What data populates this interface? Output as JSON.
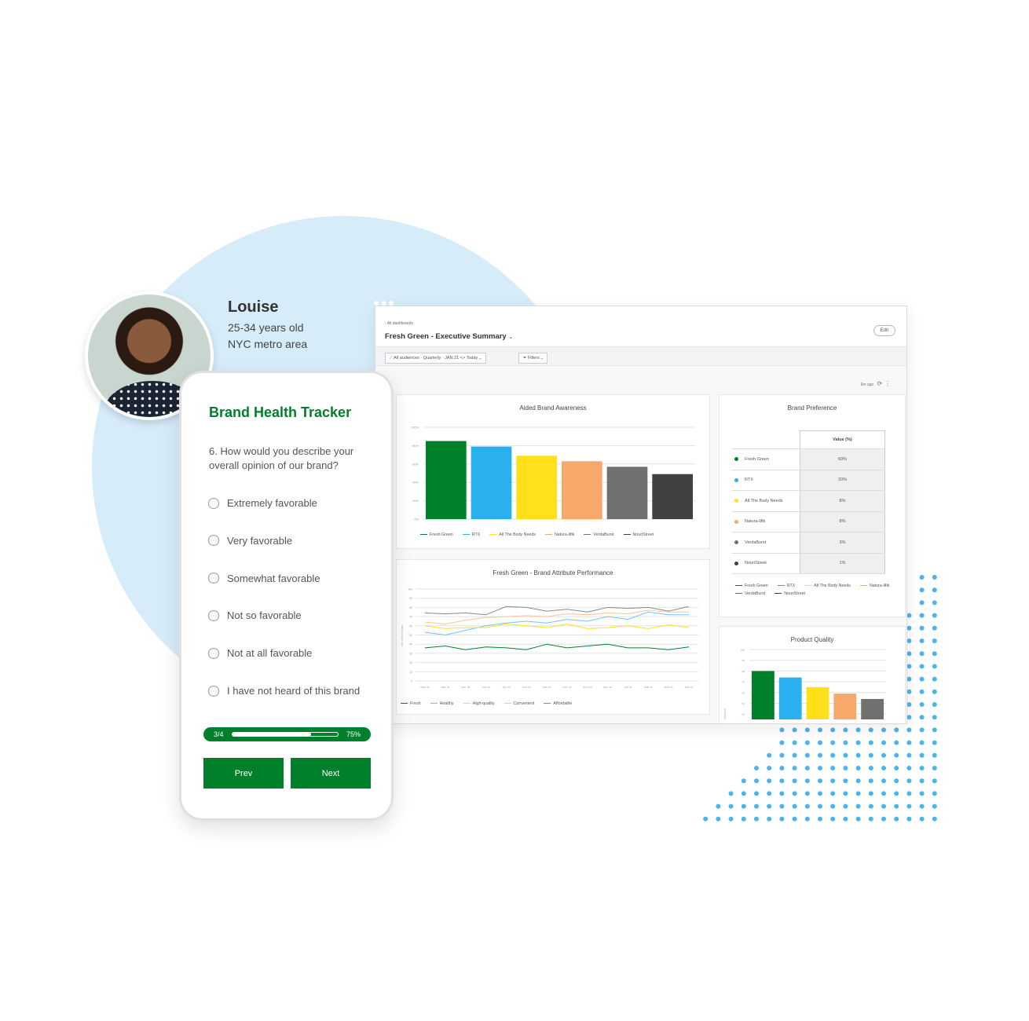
{
  "colors": {
    "brand_green": "#00802b",
    "bg_circle": "#d6ecf9",
    "dots": "#4fb3ea"
  },
  "persona": {
    "name": "Louise",
    "age": "25-34 years old",
    "location": "NYC metro area"
  },
  "dashboard": {
    "back_link": "‹ All dashboards",
    "title": "Fresh Green - Executive Summary",
    "edit_label": "Edit",
    "filter_audience": "All audiences · Quarterly · JAN 21 <> Today",
    "filter_label": "Filters",
    "updated": "6m ago"
  },
  "brand_preference": {
    "title": "Brand Preference",
    "column_header": "Value (%)",
    "rows": [
      {
        "brand": "Fresh Green",
        "value": "60%",
        "color": "#00802b"
      },
      {
        "brand": "RTX",
        "value": "20%",
        "color": "#2bb0ef"
      },
      {
        "brand": "All The Body Needs",
        "value": "8%",
        "color": "#ffe01b"
      },
      {
        "brand": "Natura-lifik",
        "value": "8%",
        "color": "#f7a86b"
      },
      {
        "brand": "VerdaBurst",
        "value": "3%",
        "color": "#707070"
      },
      {
        "brand": "NouriStreet",
        "value": "1%",
        "color": "#404040"
      }
    ]
  },
  "chart_data": [
    {
      "type": "bar",
      "title": "Aided Brand Awareness",
      "categories": [
        "Fresh Green",
        "RTX",
        "All The Body Needs",
        "Natura-lifik",
        "VerdaBurst",
        "NouriStreet"
      ],
      "values": [
        85,
        79,
        69,
        63,
        57,
        49
      ],
      "colors": [
        "#00802b",
        "#2bb0ef",
        "#ffe01b",
        "#f7a86b",
        "#707070",
        "#404040"
      ],
      "yticks": [
        "0%",
        "20%",
        "40%",
        "60%",
        "80%",
        "100%"
      ],
      "ylim": [
        0,
        100
      ],
      "grid": true,
      "legend": "bottom"
    },
    {
      "type": "line",
      "title": "Fresh Green - Brand Attribute Performance",
      "ylabel": "TOP 2 BOX SCORE",
      "x": [
        "MAR '20",
        "APR '20",
        "MAY '20",
        "JUN '20",
        "JUL '20",
        "AUG '20",
        "SEP '20",
        "OCT '20",
        "NOV '20",
        "DEC '20",
        "JAN '21",
        "FEB '21",
        "MAR '21",
        "APR '21"
      ],
      "ylim": [
        0,
        100
      ],
      "yticks": [
        "0",
        "10",
        "20",
        "30",
        "40",
        "50",
        "60",
        "70",
        "80",
        "90",
        "100"
      ],
      "grid": true,
      "legend": "bottom",
      "series": [
        {
          "name": "Fresh",
          "color": "#00802b",
          "values": [
            36,
            38,
            34,
            37,
            36,
            34,
            40,
            36,
            38,
            40,
            36,
            36,
            34,
            37
          ]
        },
        {
          "name": "Healthy",
          "color": "#6cc6f2",
          "values": [
            53,
            50,
            55,
            60,
            63,
            65,
            63,
            67,
            65,
            70,
            67,
            75,
            72,
            72
          ]
        },
        {
          "name": "High-quality",
          "color": "#ffe01b",
          "values": [
            60,
            57,
            58,
            58,
            62,
            60,
            58,
            62,
            57,
            58,
            60,
            57,
            61,
            58
          ]
        },
        {
          "name": "Convenient",
          "color": "#f9c49f",
          "values": [
            64,
            62,
            66,
            69,
            70,
            71,
            70,
            73,
            72,
            74,
            73,
            77,
            75,
            75
          ]
        },
        {
          "name": "Affordable",
          "color": "#8a8a8a",
          "values": [
            74,
            73,
            74,
            72,
            81,
            80,
            76,
            78,
            75,
            80,
            79,
            80,
            76,
            81
          ]
        }
      ]
    },
    {
      "type": "bar",
      "title": "Product Quality",
      "ylabel": "PERCENT",
      "values": [
        80,
        74,
        65,
        59,
        54
      ],
      "colors": [
        "#00802b",
        "#2bb0ef",
        "#ffe01b",
        "#f7a86b",
        "#707070"
      ],
      "yticks": [
        "40",
        "50",
        "60",
        "70",
        "80",
        "90",
        "100"
      ],
      "ylim": [
        35,
        100
      ],
      "grid": true
    }
  ],
  "survey": {
    "title": "Brand Health Tracker",
    "question": "6. How would you describe your overall opinion of our brand?",
    "options": [
      "Extremely favorable",
      "Very favorable",
      "Somewhat favorable",
      "Not so favorable",
      "Not at all favorable",
      "I have not heard of this brand"
    ],
    "progress_step": "3/4",
    "progress_percent": "75%",
    "progress_value": 0.75,
    "prev_label": "Prev",
    "next_label": "Next"
  }
}
